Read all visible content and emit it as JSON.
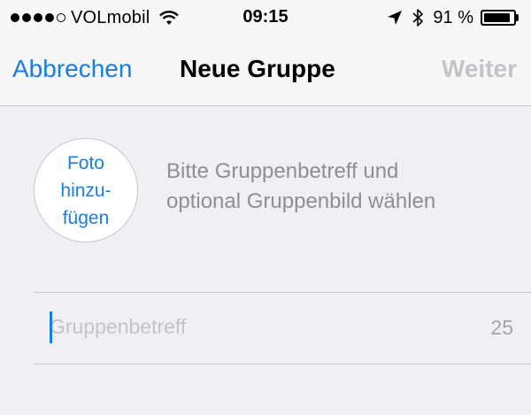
{
  "status_bar": {
    "signal_bars_filled": 4,
    "signal_bars_total": 5,
    "carrier": "VOLmobil",
    "time": "09:15",
    "battery_percent": "91 %",
    "battery_level": 0.91,
    "icons": [
      "wifi-icon",
      "location-arrow-icon",
      "bluetooth-icon",
      "battery-icon"
    ]
  },
  "nav": {
    "cancel_label": "Abbrechen",
    "title": "Neue Gruppe",
    "next_label": "Weiter"
  },
  "photo": {
    "line1": "Foto",
    "line2": "hinzu-",
    "line3": "fügen"
  },
  "instructions": {
    "line1": "Bitte Gruppenbetreff und",
    "line2": "optional Gruppenbild wählen"
  },
  "subject": {
    "placeholder": "Gruppenbetreff",
    "value": "",
    "remaining_chars": "25"
  },
  "colors": {
    "accent": "#1a7de0",
    "disabled": "#c4c4c8",
    "secondary_text": "#8e8e93",
    "background": "#efeff4"
  }
}
